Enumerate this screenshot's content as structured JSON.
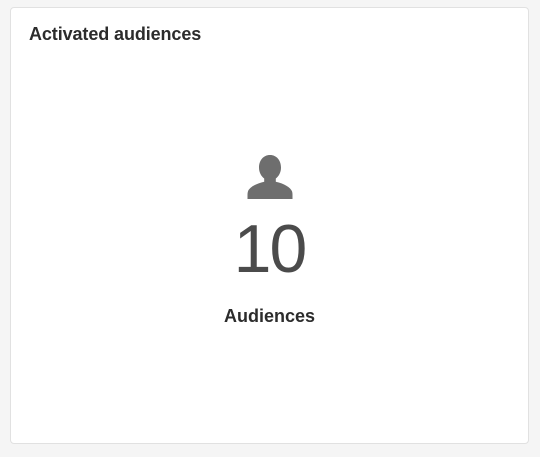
{
  "card": {
    "title": "Activated audiences",
    "metric": {
      "icon": "user-icon",
      "value": "10",
      "label": "Audiences"
    }
  },
  "colors": {
    "page_background": "#f5f5f5",
    "card_background": "#ffffff",
    "icon": "#6e6e6e",
    "text": "#2c2c2c"
  }
}
